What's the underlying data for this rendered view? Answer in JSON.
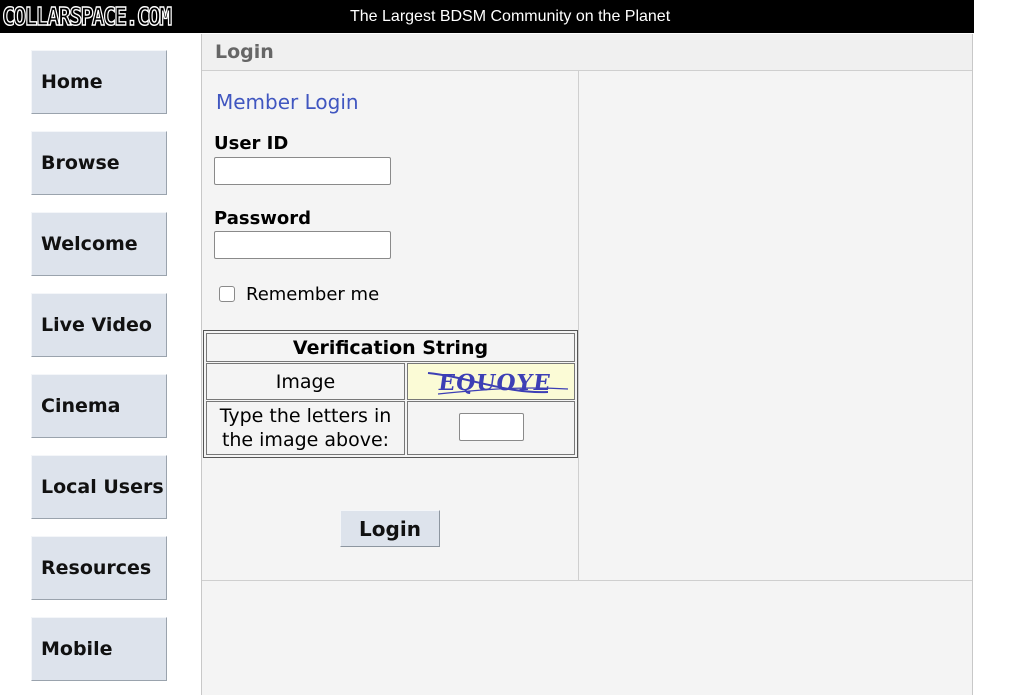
{
  "header": {
    "logo": "COLLARSPACE.COM",
    "tagline": "The Largest BDSM Community on the Planet"
  },
  "nav": {
    "items": [
      "Home",
      "Browse",
      "Welcome",
      "Live Video",
      "Cinema",
      "Local Users",
      "Resources",
      "Mobile"
    ]
  },
  "main": {
    "title": "Login",
    "form": {
      "heading": "Member Login",
      "user_label": "User ID",
      "user_value": "",
      "password_label": "Password",
      "password_value": "",
      "remember_label": "Remember me",
      "remember_checked": false,
      "verification": {
        "heading": "Verification String",
        "image_label": "Image",
        "captcha_text": "EQUOYE",
        "type_prompt": "Type the letters in the image above:",
        "code_value": ""
      },
      "submit_label": "Login"
    }
  },
  "colors": {
    "nav_button": "#dde3ec",
    "link_blue": "#4056c0",
    "captcha_bg": "#fbfbd6",
    "captcha_ink": "#3d3fb5"
  }
}
